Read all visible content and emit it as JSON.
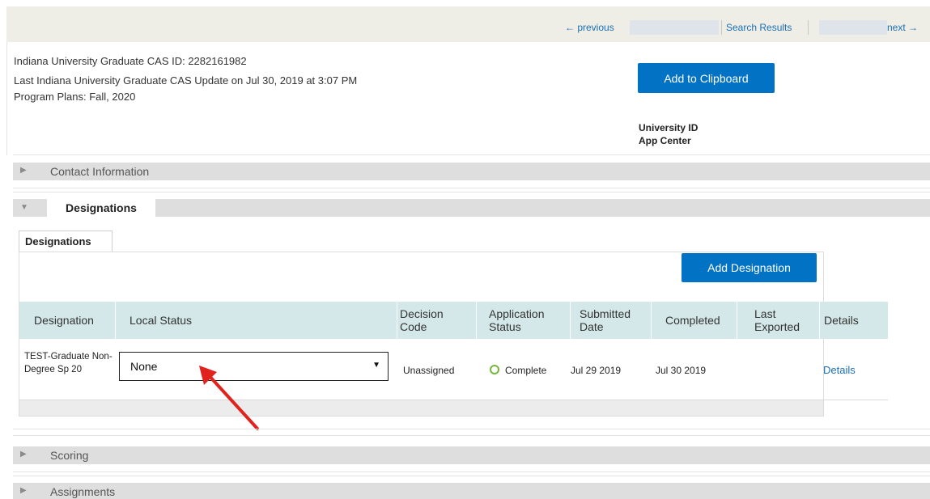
{
  "nav": {
    "previous_label": "← previous",
    "search_results_label": "Search Results",
    "next_label": "next →"
  },
  "applicant": {
    "cas_id_line": "Indiana University Graduate CAS ID: 2282161982",
    "last_update_line": "Last Indiana University Graduate CAS Update on Jul 30, 2019 at 3:07 PM",
    "program_plans_line": "Program Plans: Fall, 2020",
    "clipboard_button": "Add to Clipboard",
    "university_id_label": "University ID",
    "app_center_label": "App Center"
  },
  "sections": {
    "contact": "Contact Information",
    "designations": "Designations",
    "scoring": "Scoring",
    "assignments": "Assignments"
  },
  "designations": {
    "inner_tab": "Designations",
    "add_button": "Add Designation",
    "columns": {
      "designation": "Designation",
      "local_status": "Local Status",
      "decision_code_1": "Decision",
      "decision_code_2": "Code",
      "application_status_1": "Application",
      "application_status_2": "Status",
      "submitted_date_1": "Submitted",
      "submitted_date_2": "Date",
      "completed": "Completed",
      "last_exported_1": "Last",
      "last_exported_2": "Exported",
      "details": "Details"
    },
    "rows": [
      {
        "designation": "TEST-Graduate Non-Degree Sp 20",
        "local_status": "None",
        "decision_code": "Unassigned",
        "application_status": "Complete",
        "submitted_date": "Jul 29 2019",
        "completed": "Jul 30 2019",
        "last_exported": "",
        "details": "Details"
      }
    ]
  },
  "colors": {
    "accent": "#0273c4",
    "link": "#1a6fb5",
    "table_header": "#d4e8e9",
    "status_complete": "#74b63a",
    "annotation_arrow": "#e0231c"
  },
  "icons": {
    "collapsed": "triangle-right-icon",
    "expanded": "triangle-down-icon",
    "select": "caret-down-icon",
    "status": "status-ring-icon",
    "annotation": "red-arrow-icon"
  }
}
